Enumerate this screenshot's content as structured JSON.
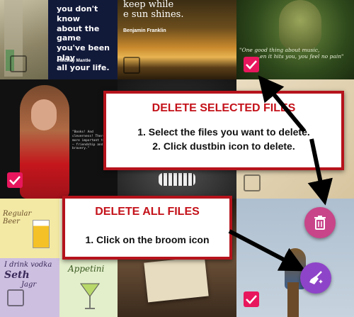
{
  "tiles": {
    "mantle_quote": [
      "you don't know",
      "about the game",
      "you've been play",
      "all your life."
    ],
    "mantle_author": "- Mickey Mantle",
    "franklin_quote": [
      "keep while",
      "e sun shines."
    ],
    "franklin_author": "Benjamin Franklin",
    "marley_quote": [
      "\"One good thing about music,",
      "...en it hits you, you feel no pain\""
    ],
    "movie_quote": "\"Books! And cleverness! There are more important things — friendship and bravery.\"",
    "drinks_regular": "Regular Beer",
    "drinks_vodka": [
      "I drink vodka",
      "Seth",
      "Jagr"
    ],
    "drinks_appetini": "Appetini"
  },
  "callout_selected": {
    "heading": "DELETE SELECTED FILES",
    "step1": "1. Select the files you want to delete.",
    "step2": "2. Click dustbin icon to delete."
  },
  "callout_all": {
    "heading": "DELETE ALL FILES",
    "step1": "1. Click on the broom icon"
  },
  "icons": {
    "delete_fab": "trash-icon",
    "clear_all_fab": "broom-icon",
    "checkbox_checked": "check-icon"
  },
  "colors": {
    "callout_border": "#b5131c",
    "callout_heading": "#c4121a",
    "checkbox_on": "#e8175d",
    "delete_fab": "#c8458a",
    "broom_fab": "#8e44c8"
  }
}
